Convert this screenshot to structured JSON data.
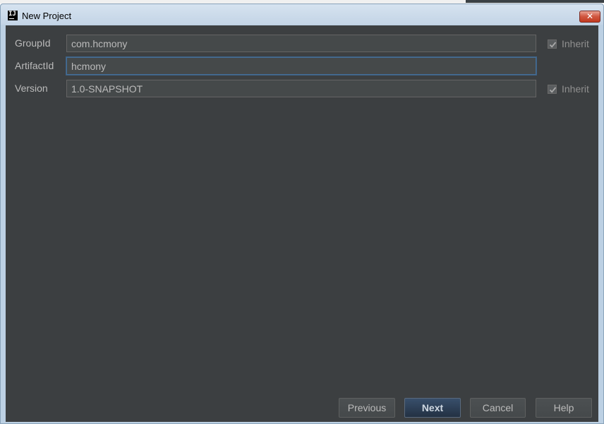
{
  "window": {
    "title": "New Project",
    "app_icon_text": "IJ",
    "close_symbol": "✕"
  },
  "form": {
    "group_id": {
      "label": "GroupId",
      "value": "com.hcmony",
      "inherit_label": "Inherit",
      "inherit_checked": true
    },
    "artifact_id": {
      "label": "ArtifactId",
      "value": "hcmony"
    },
    "version": {
      "label": "Version",
      "value": "1.0-SNAPSHOT",
      "inherit_label": "Inherit",
      "inherit_checked": true
    }
  },
  "buttons": {
    "previous": "Previous",
    "next": "Next",
    "cancel": "Cancel",
    "help": "Help"
  },
  "colors": {
    "content_background": "#3c3f41",
    "field_background": "#45494a",
    "text": "#bbbbbb",
    "focus_border": "#466d94",
    "primary_button": "#2c3e55",
    "close_button": "#c9472e"
  },
  "icons": {
    "app": "intellij-app-icon",
    "close": "close-icon",
    "checkbox": "checkmark-icon"
  }
}
